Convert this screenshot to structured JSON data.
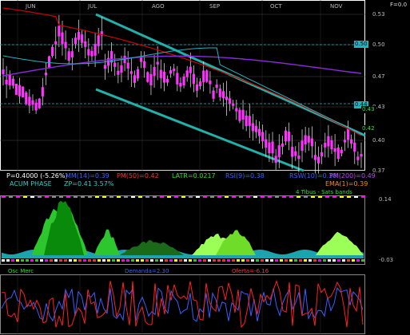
{
  "months": [
    "JUN",
    "JUL",
    "AGO",
    "SEP",
    "OCT",
    "NOV"
  ],
  "top_right_label": "F=0.0",
  "price_axis": [
    "0.53",
    "0.50",
    "0.47",
    "0.43",
    "0.40",
    "0.37"
  ],
  "price_tags": {
    "a": "0.50",
    "b": "0.44",
    "c": "0.43",
    "d": "0.42"
  },
  "status_row1": {
    "p": "P=0.4000 (-5.26%)",
    "mm": "MM(14)=0.39",
    "pm50": "PM(50)=0.42",
    "latr": "LATR=0.0217",
    "rsi": "RSI(9)=0.38",
    "rsw": "RSW(10)=0.38",
    "pm200": "PM(200)=0.49"
  },
  "status_row2": {
    "acum": "ACUM PHASE",
    "zp": "ZP=0.41",
    "pct": "3.57%",
    "ema": "EMA(1)=0.39"
  },
  "mid_header": "4 Tibus - Sats bands",
  "mid_axis": {
    "top": "0.14",
    "bottom": "-0.03"
  },
  "bottom_header": {
    "left": "Osc Merc",
    "mid": "Demanda=2.30",
    "right": "Oferta=-6.16"
  },
  "colors": {
    "frame": "#ffffff",
    "channel": "#20b2aa",
    "candle": "#ff33ff",
    "ma_red": "#cc0000",
    "ma_purple": "#8a2be2",
    "ma_cyan": "#1fb6c1",
    "bands_green": "#2ec62e",
    "bands_light": "#9cff57"
  }
}
